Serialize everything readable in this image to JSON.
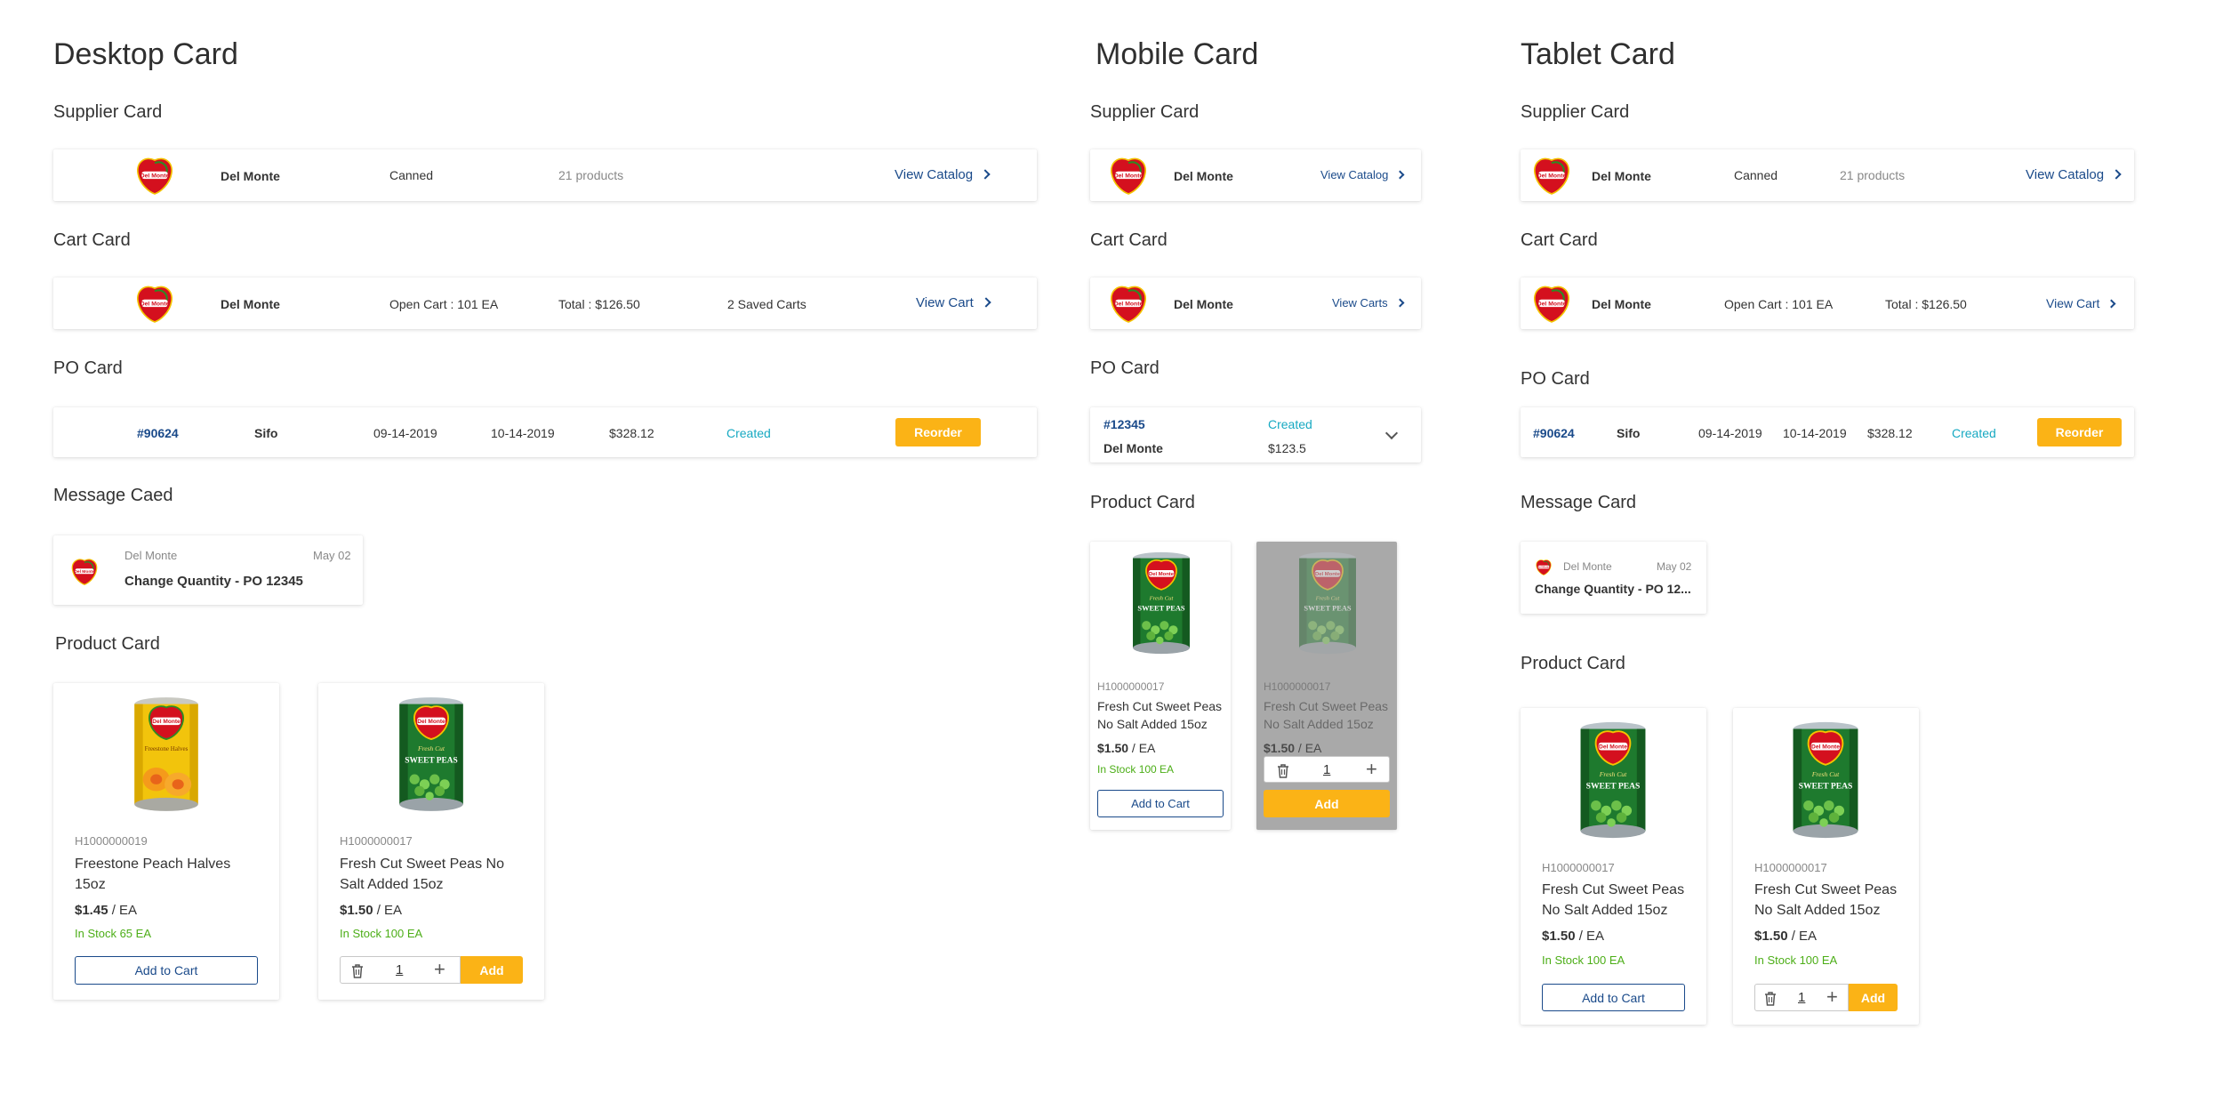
{
  "sections": {
    "desktop": "Desktop Card",
    "mobile": "Mobile Card",
    "tablet": "Tablet Card"
  },
  "labels": {
    "supplier": "Supplier Card",
    "cart": "Cart Card",
    "po": "PO Card",
    "message": "Message Caed",
    "message_tablet": "Message Card",
    "product": "Product Card"
  },
  "supplier": {
    "name": "Del Monte",
    "category": "Canned",
    "products": "21 products",
    "link": "View Catalog"
  },
  "cart": {
    "name": "Del Monte",
    "open_cart": "Open Cart : 101 EA",
    "total": "Total : $126.50",
    "saved": "2 Saved Carts",
    "link": "View Cart",
    "link_mobile": "View Carts"
  },
  "po": {
    "number": "#90624",
    "supplier": "Sifo",
    "date1": "09-14-2019",
    "date2": "10-14-2019",
    "amount": "$328.12",
    "status": "Created",
    "action": "Reorder",
    "mobile_number": "#12345",
    "mobile_supplier": "Del Monte",
    "mobile_amount": "$123.5"
  },
  "message": {
    "from": "Del Monte",
    "date": "May 02",
    "subject": "Change Quantity - PO 12345",
    "subject_short": "Change Quantity - PO 12..."
  },
  "products": {
    "peach": {
      "sku": "H1000000019",
      "name_l1": "Freestone Peach Halves",
      "name_l2": "15oz",
      "price": "$1.45",
      "unit": " / EA",
      "stock": "In Stock 65 EA"
    },
    "peas_desktop": {
      "sku": "H1000000017",
      "name_l1": "Fresh Cut Sweet Peas No",
      "name_l2": "Salt Added 15oz",
      "price": "$1.50",
      "unit": " / EA",
      "stock": "In Stock 100 EA"
    },
    "peas": {
      "sku": "H1000000017",
      "name_l1": "Fresh Cut Sweet Peas",
      "name_l2": "No Salt Added 15oz",
      "price": "$1.50",
      "unit": " / EA",
      "stock": "In Stock 100 EA"
    },
    "add_to_cart": "Add to Cart",
    "add": "Add",
    "qty": "1"
  },
  "colors": {
    "accent_yellow": "#fbb316",
    "link_blue": "#1a4a8a",
    "status_teal": "#17a9c2",
    "stock_green": "#4cae17"
  }
}
